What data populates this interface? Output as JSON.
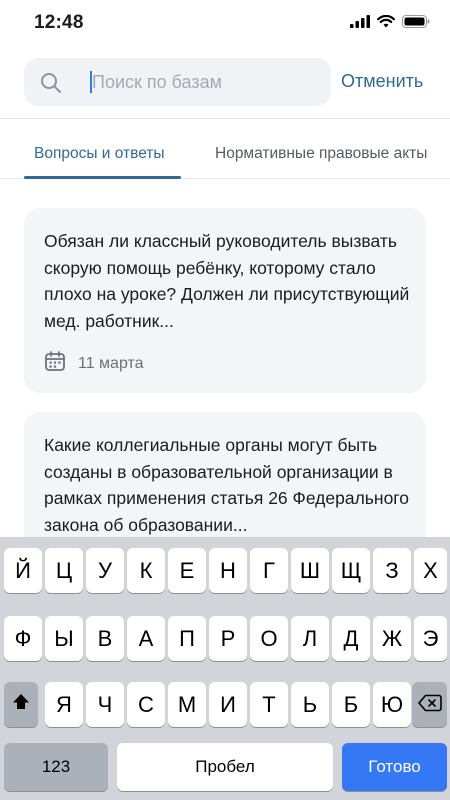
{
  "status_bar": {
    "time": "12:48",
    "icons": [
      "signal-icon",
      "wifi-icon",
      "battery-icon"
    ]
  },
  "search": {
    "placeholder": "Поиск по базам",
    "value": "",
    "cancel_label": "Отменить"
  },
  "tabs": [
    {
      "label": "Вопросы и ответы",
      "active": true
    },
    {
      "label": "Нормативные правовые акты",
      "active": false
    }
  ],
  "results": [
    {
      "text": "Обязан ли классный руководитель вызвать скорую помощь ребёнку, которому стало плохо на уроке? Должен ли присутствующий мед. работник...",
      "date": "11 марта"
    },
    {
      "text": "Какие коллегиальные органы могут быть созданы в образовательной организации в рамках применения статья 26 Федерального закона об образовании...",
      "date": ""
    }
  ],
  "keyboard": {
    "row1": [
      "Й",
      "Ц",
      "У",
      "К",
      "Е",
      "Н",
      "Г",
      "Ш",
      "Щ",
      "З",
      "Х"
    ],
    "row2": [
      "Ф",
      "Ы",
      "В",
      "А",
      "П",
      "Р",
      "О",
      "Л",
      "Д",
      "Ж",
      "Э"
    ],
    "row3": [
      "Я",
      "Ч",
      "С",
      "М",
      "И",
      "Т",
      "Ь",
      "Б",
      "Ю"
    ],
    "numbers_label": "123",
    "space_label": "Пробел",
    "done_label": "Готово"
  },
  "colors": {
    "accent": "#2f6a96",
    "done_button": "#3478f6",
    "card_bg": "#f4f5f7",
    "keyboard_bg": "#d2d4da"
  }
}
